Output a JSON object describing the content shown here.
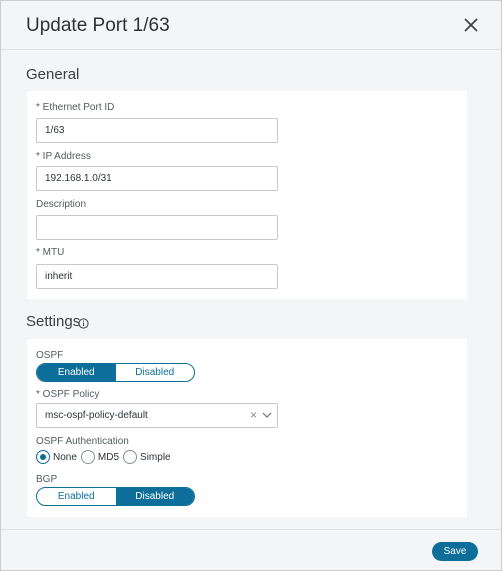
{
  "dialog": {
    "title": "Update Port 1/63",
    "close_icon": "close-icon"
  },
  "general": {
    "section_title": "General",
    "ethernet_port_id": {
      "label": "* Ethernet Port ID",
      "value": "1/63"
    },
    "ip_address": {
      "label": "* IP Address",
      "value": "192.168.1.0/31"
    },
    "description": {
      "label": "Description",
      "value": ""
    },
    "mtu": {
      "label": "* MTU",
      "value": "inherit"
    }
  },
  "settings": {
    "section_title": "Settings",
    "info_icon": "info-icon",
    "ospf": {
      "label": "OSPF",
      "options": [
        "Enabled",
        "Disabled"
      ],
      "selected": "Enabled"
    },
    "ospf_policy": {
      "label": "* OSPF Policy",
      "value": "msc-ospf-policy-default",
      "clear_glyph": "×"
    },
    "ospf_authentication": {
      "label": "OSPF Authentication",
      "options": [
        "None",
        "MD5",
        "Simple"
      ],
      "selected": "None"
    },
    "bgp": {
      "label": "BGP",
      "options": [
        "Enabled",
        "Disabled"
      ],
      "selected": "Disabled"
    }
  },
  "footer": {
    "save_label": "Save"
  },
  "colors": {
    "accent": "#0d6e9a",
    "background": "#f4f5f7",
    "panel": "#ffffff"
  }
}
